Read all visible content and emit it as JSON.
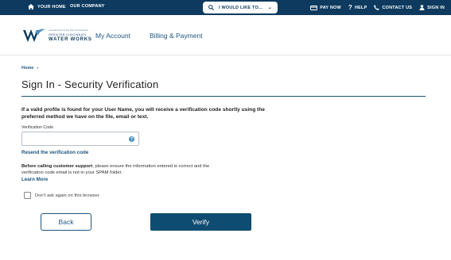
{
  "topbar": {
    "your_home": "YOUR HOME",
    "our_company": "OUR COMPANY",
    "search_label": "I WOULD LIKE TO...",
    "pay_now": "PAY NOW",
    "help": "HELP",
    "contact_us": "CONTACT US",
    "sign_in": "SIGN IN"
  },
  "logo": {
    "tagline": "a department of the City of Cincinnati",
    "line1": "GREATER CINCINNATI",
    "line2": "WATER WORKS"
  },
  "nav": {
    "my_account": "My Account",
    "billing": "Billing & Payment"
  },
  "breadcrumb": {
    "home": "Home",
    "separator": "›"
  },
  "page_title": "Sign In - Security Verification",
  "intro": "If a valid profile is found for your User Name, you will receive a verification code shortly using the preferred method we have on the file, email or text.",
  "verification": {
    "label": "Verification Code",
    "value": "",
    "help_glyph": "?"
  },
  "resend_link": "Resend the verification code",
  "note": {
    "bold": "Before calling customer support",
    "text": ", please ensure the information entered is correct and the verification code email is not in your SPAM folder."
  },
  "learn_more": "Learn More",
  "remember_label": "Don't ask again on this browser",
  "remember_checked": false,
  "buttons": {
    "back": "Back",
    "verify": "Verify"
  },
  "icons": {
    "home": "home-icon",
    "search": "search-icon",
    "caret": "chevron-down-icon",
    "pay": "credit-card-icon",
    "help": "question-icon",
    "phone": "phone-icon",
    "user": "user-icon"
  },
  "colors": {
    "topbar": "#0d3a5e",
    "accent": "#1e5680",
    "verify_button": "#0f4c71"
  }
}
